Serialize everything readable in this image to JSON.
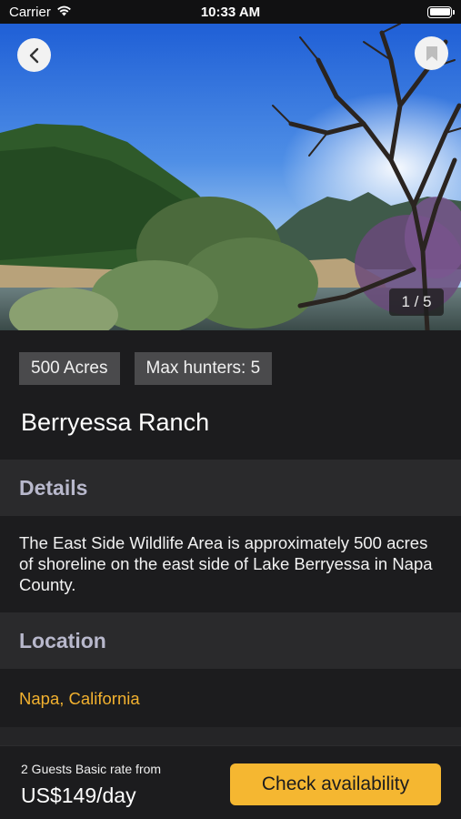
{
  "status_bar": {
    "carrier": "Carrier",
    "time": "10:33 AM",
    "wifi_icon": "wifi-icon",
    "battery_icon": "battery-icon"
  },
  "gallery": {
    "indicator": "1 / 5",
    "back_icon": "chevron-left-icon",
    "bookmark_icon": "bookmark-icon"
  },
  "listing": {
    "tags": [
      "500 Acres",
      "Max hunters: 5"
    ],
    "title": "Berryessa Ranch"
  },
  "details": {
    "header": "Details",
    "text": "The East Side Wildlife Area is approximately 500 acres of shoreline on the east side of Lake Berryessa in Napa County."
  },
  "location": {
    "header": "Location",
    "place": "Napa, California"
  },
  "booking": {
    "caption": "2 Guests Basic rate from",
    "price": "US$149/day",
    "cta_label": "Check availability"
  },
  "colors": {
    "background": "#1c1c1e",
    "section_header_bg": "#2a2a2c",
    "accent": "#f5b731",
    "location_text": "#f2b12f",
    "tag_bg": "#4a4a4c"
  }
}
